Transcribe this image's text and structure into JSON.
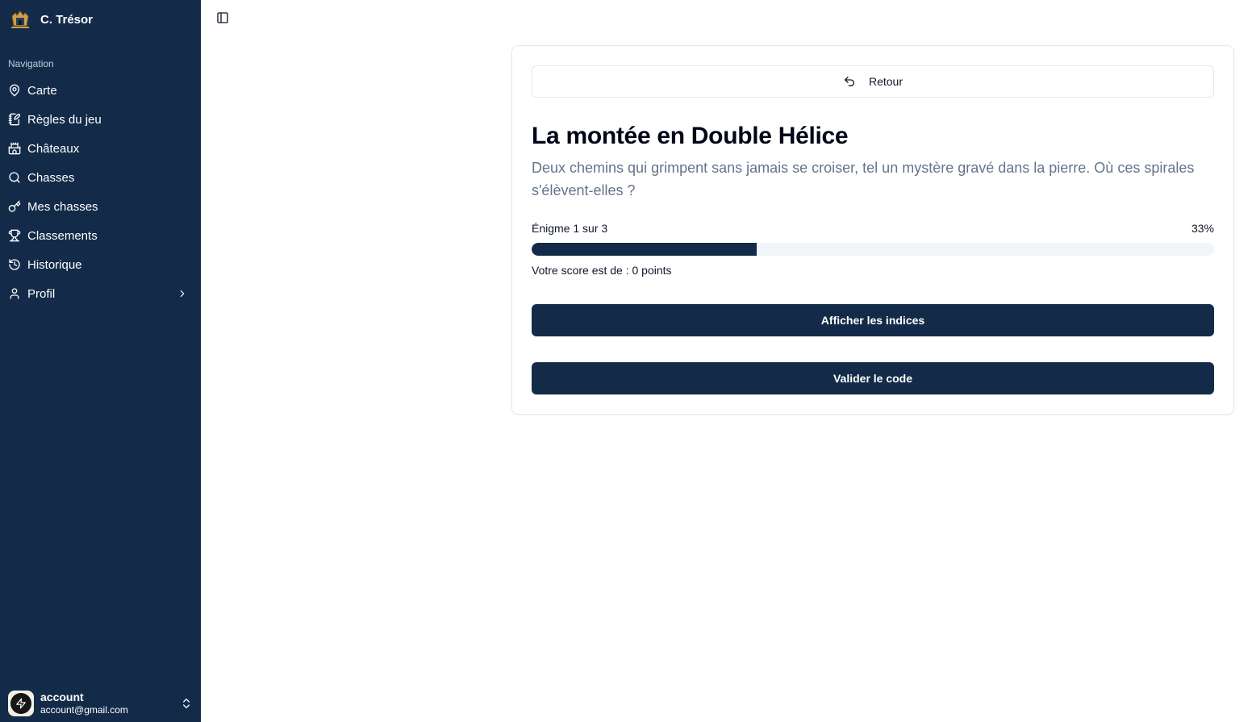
{
  "brand": {
    "name": "C. Trésor",
    "logo_icon": "castle-crest-icon"
  },
  "sidebar": {
    "heading": "Navigation",
    "items": [
      {
        "label": "Carte",
        "icon": "map-pin-icon"
      },
      {
        "label": "Règles du jeu",
        "icon": "rules-notebook-icon"
      },
      {
        "label": "Châteaux",
        "icon": "castle-icon"
      },
      {
        "label": "Chasses",
        "icon": "search-icon"
      },
      {
        "label": "Mes chasses",
        "icon": "key-icon"
      },
      {
        "label": "Classements",
        "icon": "trophy-icon"
      },
      {
        "label": "Historique",
        "icon": "history-icon"
      },
      {
        "label": "Profil",
        "icon": "user-icon",
        "has_submenu": true
      }
    ]
  },
  "account": {
    "name": "account",
    "email": "account@gmail.com"
  },
  "riddle": {
    "back_label": "Retour",
    "title": "La montée en Double Hélice",
    "description": "Deux chemins qui grimpent sans jamais se croiser, tel un mystère gravé dans la pierre. Où ces spirales s'élèvent-elles ?",
    "progress_label": "Énigme 1 sur 3",
    "progress_percent_label": "33%",
    "progress_value": 0.33,
    "score_text": "Votre score est de : 0 points",
    "hints_button": "Afficher les indices",
    "validate_button": "Valider le code"
  },
  "colors": {
    "sidebar_bg": "#132b49",
    "primary": "#132b49",
    "muted_text": "#64748b"
  }
}
